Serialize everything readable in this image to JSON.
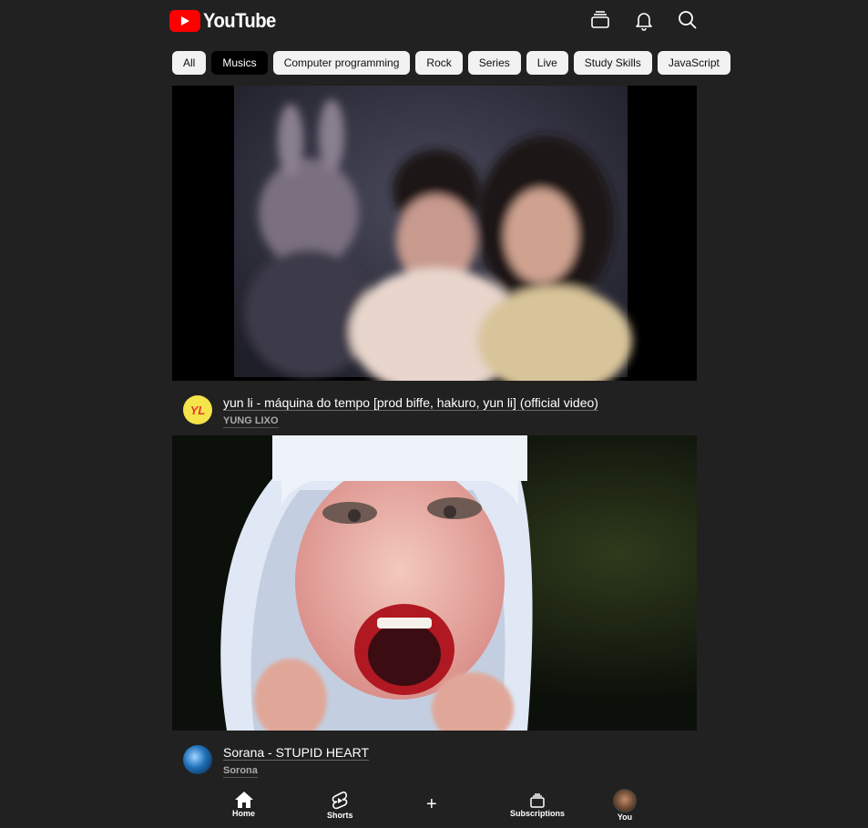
{
  "header": {
    "logo_text": "YouTube",
    "icons": [
      "cast-icon",
      "bell-icon",
      "search-icon"
    ]
  },
  "chips": [
    "All",
    "Musics",
    "Computer programming",
    "Rock",
    "Series",
    "Live",
    "Study Skills",
    "JavaScript"
  ],
  "active_chip": "Musics",
  "videos": [
    {
      "title": "yun li - máquina do tempo [prod biffe, hakuro, yun li] (official video)",
      "channel": "YUNG LIXO",
      "avatar_text": "YL"
    },
    {
      "title": "Sorana - STUPID HEART",
      "channel": "Sorona"
    }
  ],
  "bottom_nav": {
    "home": "Home",
    "shorts": "Shorts",
    "create": "+",
    "subscriptions": "Subscriptions",
    "you": "You"
  },
  "colors": {
    "background": "#212121",
    "brand_red": "#ff0000",
    "chip_bg": "#f2f2f2",
    "chip_active_bg": "#000000"
  }
}
